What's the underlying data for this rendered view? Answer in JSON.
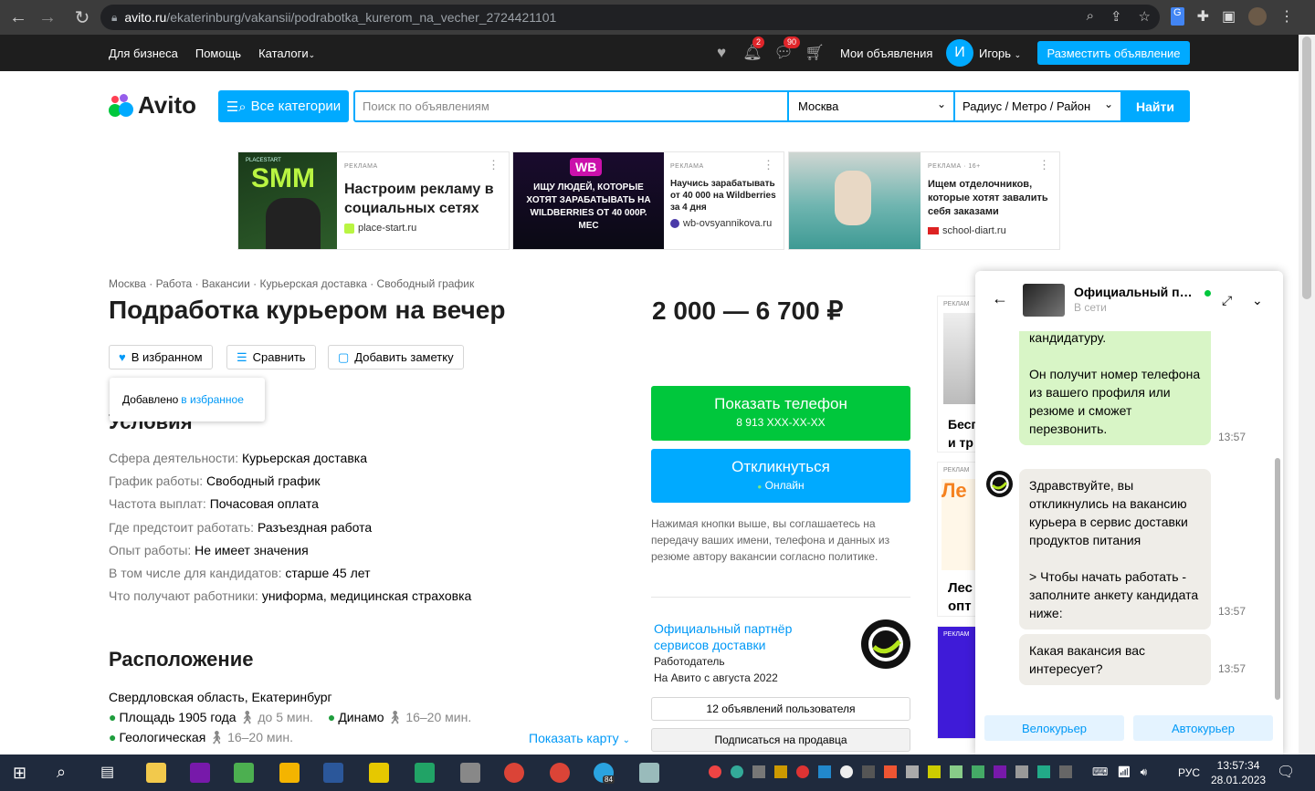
{
  "browser": {
    "url_host": "avito.ru",
    "url_path": "/ekaterinburg/vakansii/podrabotka_kurerom_na_vecher_2724421101"
  },
  "topnav": {
    "links": [
      "Для бизнеса",
      "Помощь",
      "Каталоги"
    ],
    "notif_count": "2",
    "msg_count": "90",
    "my_ads": "Мои объявления",
    "avatar_letter": "И",
    "user_name": "Игорь",
    "post_button": "Разместить объявление"
  },
  "header": {
    "logo": "Avito",
    "categories_button": "Все категории",
    "search_placeholder": "Поиск по объявлениям",
    "city": "Москва",
    "radius": "Радиус / Метро / Район",
    "find_button": "Найти"
  },
  "ads": [
    {
      "label": "РЕКЛАМА",
      "title": "Настроим рекламу в социальных сетях",
      "domain": "place-start.ru",
      "img_text": "SMM",
      "img_brand": "PLACESTART"
    },
    {
      "label": "РЕКЛАМА",
      "title": "Научись зарабатывать от 40 000 на Wildberries за 4 дня",
      "domain": "wb-ovsyannikova.ru",
      "img_text": "ИЩУ ЛЮДЕЙ, КОТОРЫЕ ХОТЯТ ЗАРАБАТЫВАТЬ НА WILDBERRIES ОТ 40 000Р. МЕС",
      "img_brand": "WB"
    },
    {
      "label": "РЕКЛАМА · 16+",
      "title": "Ищем отделочников, которые хотят завалить себя заказами",
      "domain": "school-diart.ru"
    }
  ],
  "listing": {
    "breadcrumbs": "Москва · Работа · Вакансии · Курьерская доставка · Свободный график",
    "title": "Подработка курьером на вечер",
    "price": "2 000 — 6 700 ₽",
    "actions": {
      "favorite": "В избранном",
      "compare": "Сравнить",
      "note": "Добавить заметку"
    },
    "tooltip_prefix": "Добавлено",
    "tooltip_link": "в избранное",
    "conditions_title": "Условия",
    "params": [
      {
        "k": "Сфера деятельности:",
        "v": "Курьерская доставка"
      },
      {
        "k": "График работы:",
        "v": "Свободный график"
      },
      {
        "k": "Частота выплат:",
        "v": "Почасовая оплата"
      },
      {
        "k": "Где предстоит работать:",
        "v": "Разъездная работа"
      },
      {
        "k": "Опыт работы:",
        "v": "Не имеет значения"
      },
      {
        "k": "В том числе для кандидатов:",
        "v": "старше 45 лет"
      },
      {
        "k": "Что получают работники:",
        "v": "униформа, медицинская страховка"
      }
    ],
    "location_title": "Расположение",
    "address": "Свердловская область, Екатеринбург",
    "metro": [
      {
        "name": "Площадь 1905 года",
        "time": "до 5 мин."
      },
      {
        "name": "Динамо",
        "time": "16–20 мин."
      },
      {
        "name": "Геологическая",
        "time": "16–20 мин."
      }
    ],
    "show_map": "Показать карту"
  },
  "sidebar": {
    "call_button": "Показать телефон",
    "phone": "8 913 XXX-XX-XX",
    "respond_button": "Откликнуться",
    "respond_status": "Онлайн",
    "note": "Нажимая кнопки выше, вы соглашаетесь на передачу ваших имени, телефона и данных из резюме автору вакансии согласно политике.",
    "seller_name": "Официальный партнёр сервисов доставки",
    "seller_role": "Работодатель",
    "seller_since": "На Авито с августа 2022",
    "user_ads": "12 объявлений пользователя",
    "subscribe": "Подписаться на продавца"
  },
  "side_ads": [
    {
      "label": "РЕКЛАМ",
      "text": "Бесп и тр"
    },
    {
      "label": "РЕКЛАМ",
      "text": "Лес опт"
    },
    {
      "label": "РЕКЛАМ",
      "text": ""
    }
  ],
  "chat": {
    "name": "Официальный партнёр сервисов доставки",
    "status": "В сети",
    "messages": [
      {
        "from": "me",
        "text": "кандидатуру.\n\nОн получит номер телефона из вашего профиля или резюме и сможет перезвонить.",
        "time": "13:57"
      },
      {
        "from": "them",
        "text": "Здравствуйте, вы откликнулись на вакансию курьера в сервис доставки продуктов питания\n\n> Чтобы начать работать - заполните анкету кандидата ниже:",
        "time": "13:57"
      },
      {
        "from": "them",
        "text": "Какая вакансия вас интересует?",
        "time": "13:57"
      }
    ],
    "quick_replies": [
      "Велокурьер",
      "Автокурьер"
    ]
  },
  "taskbar": {
    "lang": "РУС",
    "time": "13:57:34",
    "date": "28.01.2023",
    "telegram_badge": "84"
  },
  "colors": {
    "accent": "#00aaff",
    "green": "#00c73c",
    "dark": "#1e1e1e"
  }
}
